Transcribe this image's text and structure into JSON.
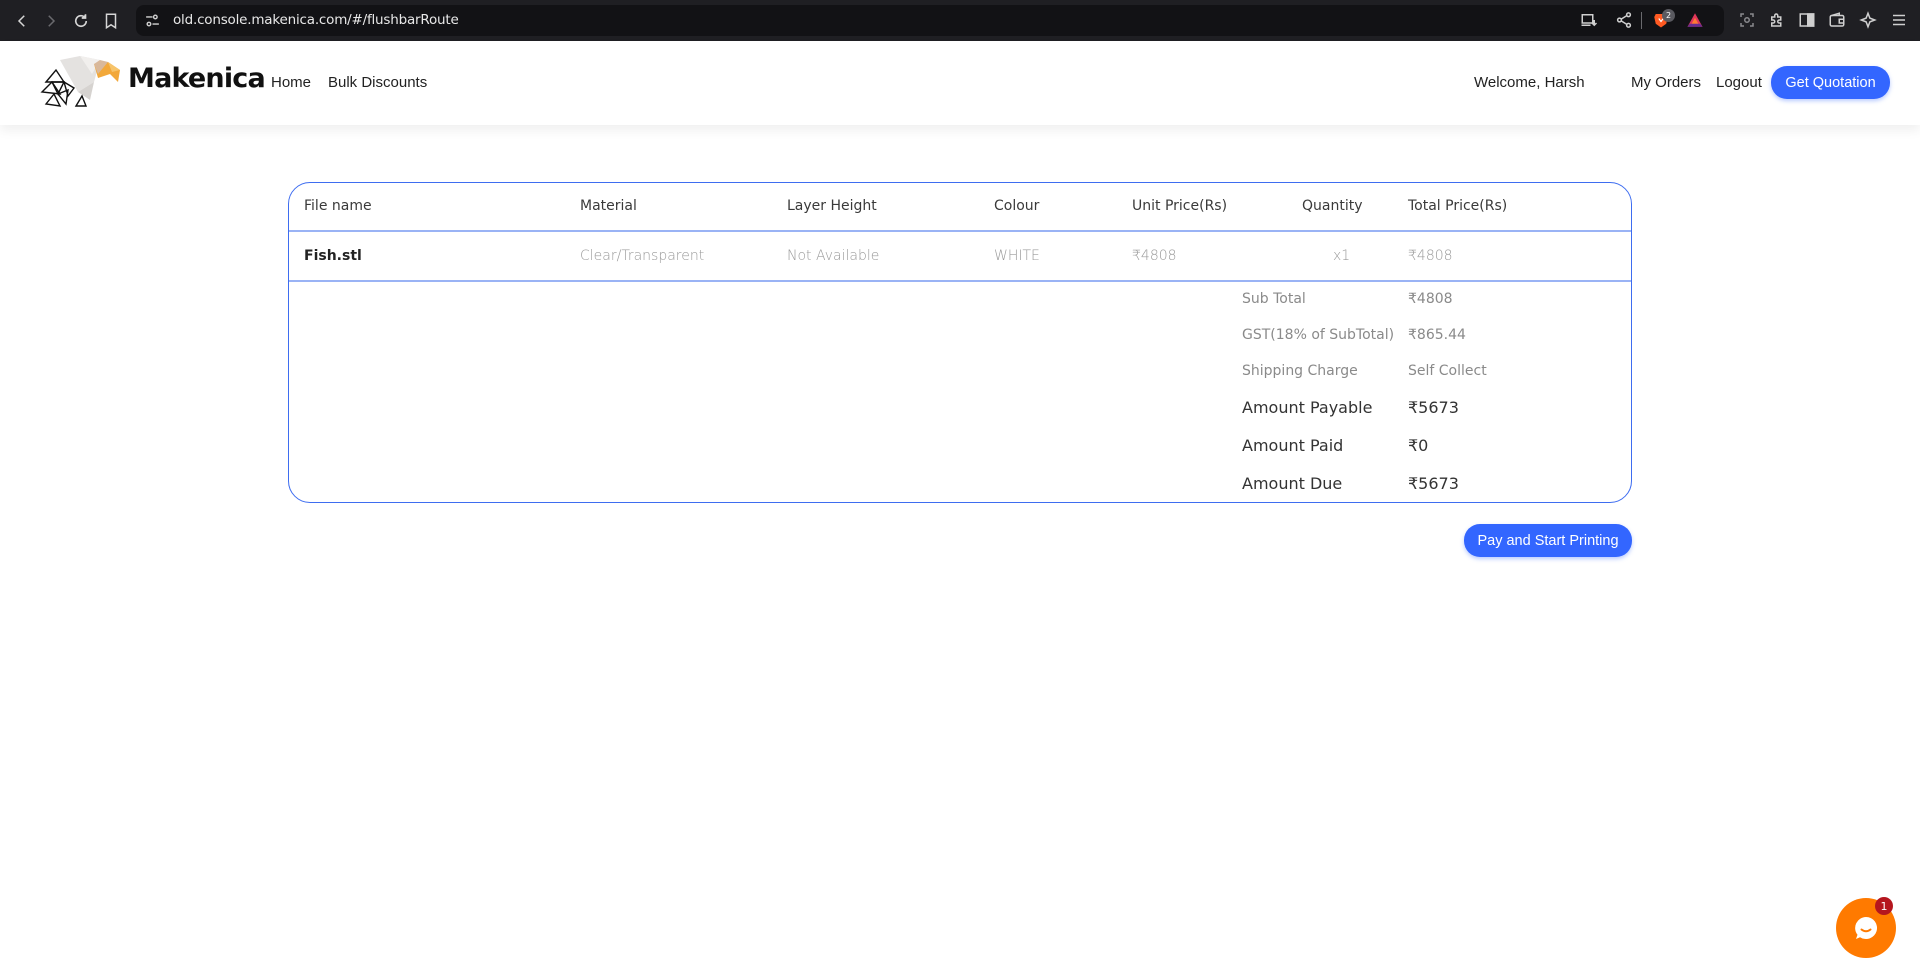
{
  "browser": {
    "url": "old.console.makenica.com/#/flushbarRoute",
    "brave_shield_count": "2"
  },
  "header": {
    "brand": "Makenica",
    "nav": [
      {
        "label": "Home"
      },
      {
        "label": "Bulk Discounts"
      }
    ],
    "welcome": "Welcome, Harsh",
    "my_orders": "My Orders",
    "logout": "Logout",
    "get_quotation": "Get Quotation"
  },
  "order": {
    "columns": [
      "File name",
      "Material",
      "Layer Height",
      "Colour",
      "Unit Price(Rs)",
      "Quantity",
      "Total Price(Rs)"
    ],
    "items": [
      {
        "file_name": "Fish.stl",
        "material": "Clear/Transparent",
        "layer_height": "Not Available",
        "colour": "WHITE",
        "unit_price": "₹4808",
        "quantity": "x1",
        "total_price": "₹4808"
      }
    ],
    "summary": [
      {
        "label": "Sub Total",
        "value": "₹4808"
      },
      {
        "label": "GST(18% of SubTotal)",
        "value": "₹865.44"
      },
      {
        "label": "Shipping Charge",
        "value": "Self Collect"
      },
      {
        "label": "Amount Payable",
        "value": "₹5673"
      },
      {
        "label": "Amount Paid",
        "value": "₹0"
      },
      {
        "label": "Amount Due",
        "value": "₹5673"
      }
    ]
  },
  "actions": {
    "pay_button": "Pay and Start Printing"
  },
  "chat": {
    "unread_count": "1"
  },
  "colors": {
    "primary": "#3366ff",
    "card_border": "#3e6df0",
    "chat_widget": "#ff7a00",
    "badge": "#b5161e"
  }
}
